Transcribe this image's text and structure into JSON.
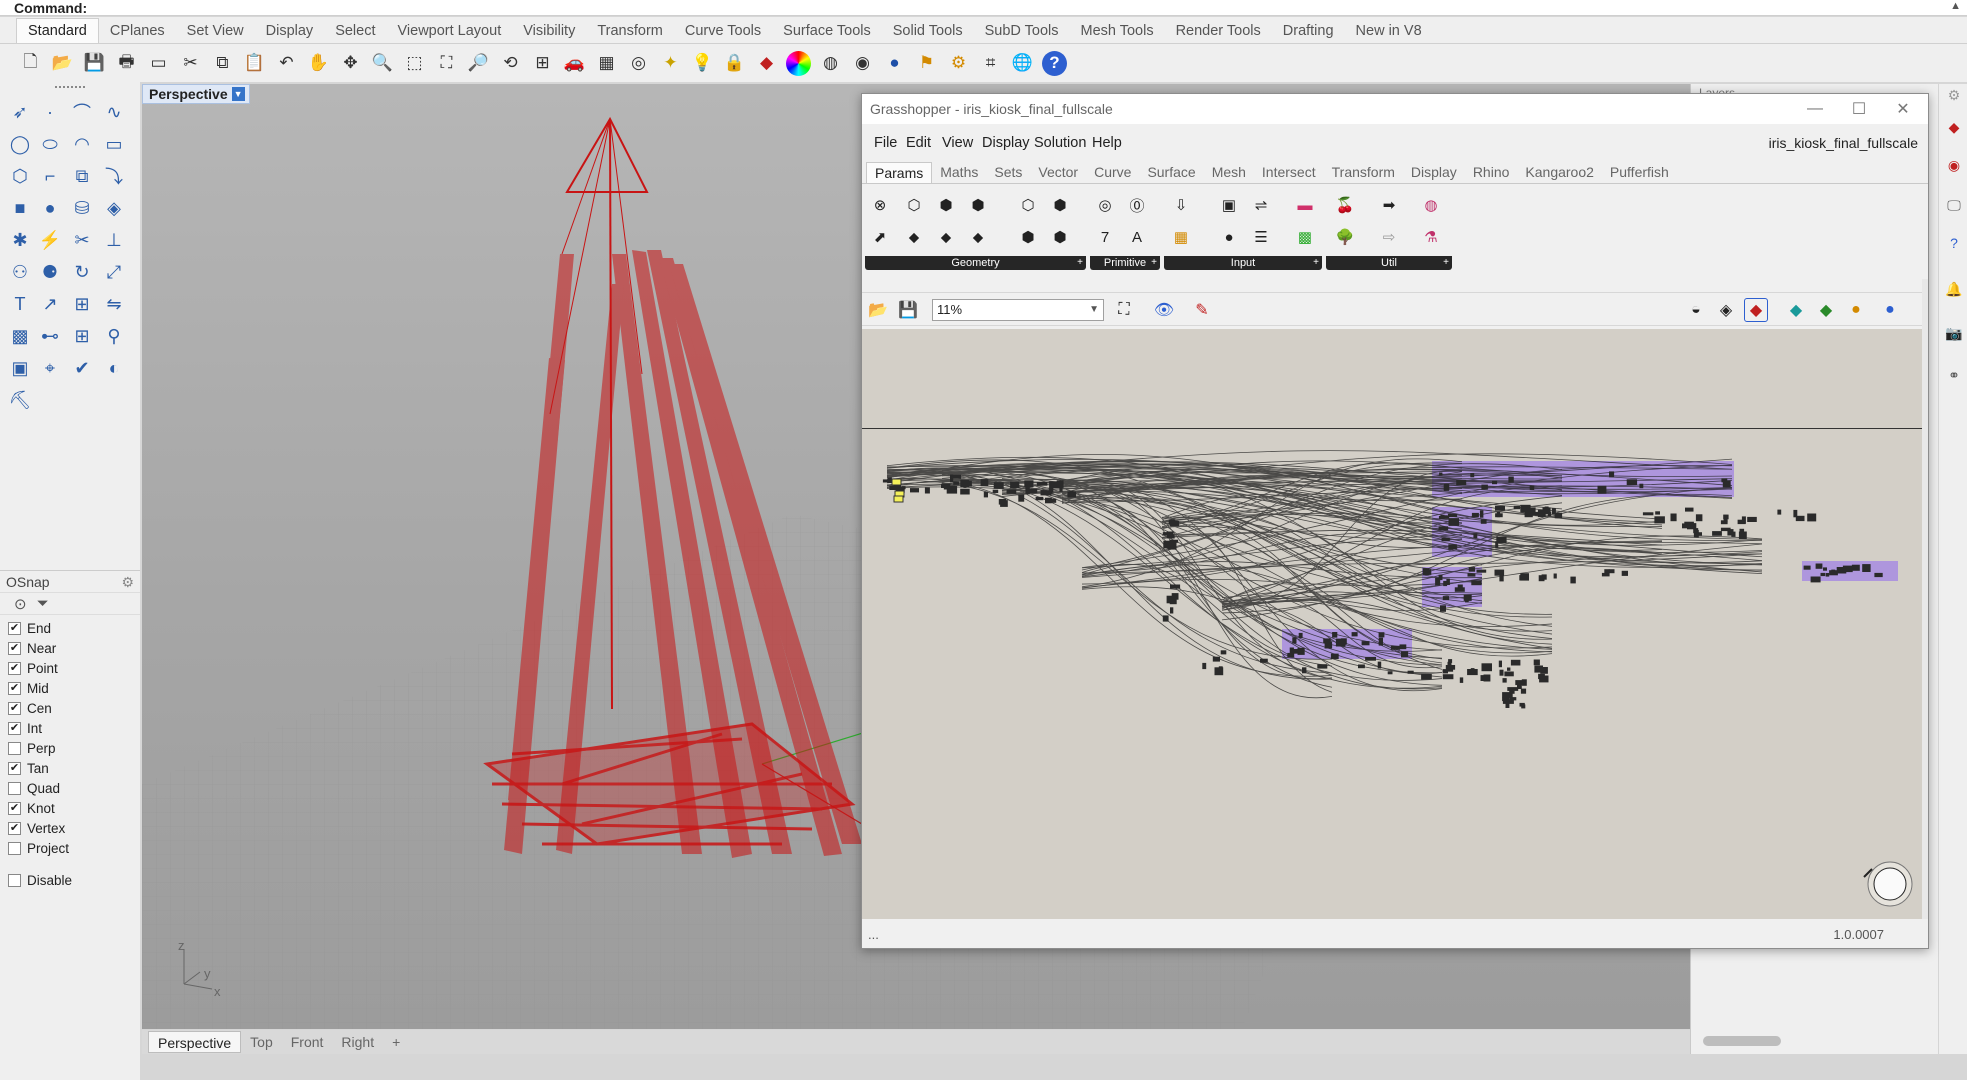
{
  "command_bar": {
    "label": "Command:"
  },
  "tabs": [
    "Standard",
    "CPlanes",
    "Set View",
    "Display",
    "Select",
    "Viewport Layout",
    "Visibility",
    "Transform",
    "Curve Tools",
    "Surface Tools",
    "Solid Tools",
    "SubD Tools",
    "Mesh Tools",
    "Render Tools",
    "Drafting",
    "New in V8"
  ],
  "active_tab": "Standard",
  "viewport": {
    "title": "Perspective",
    "axis_z": "z",
    "axis_y": "y",
    "axis_x": "x",
    "tabs": [
      "Perspective",
      "Top",
      "Front",
      "Right"
    ],
    "active_tab": "Perspective",
    "add_tab_icon": "+",
    "model_color": "#c81414"
  },
  "osnap": {
    "title": "OSnap",
    "items": [
      {
        "label": "End",
        "checked": true
      },
      {
        "label": "Near",
        "checked": true
      },
      {
        "label": "Point",
        "checked": true
      },
      {
        "label": "Mid",
        "checked": true
      },
      {
        "label": "Cen",
        "checked": true
      },
      {
        "label": "Int",
        "checked": true
      },
      {
        "label": "Perp",
        "checked": false
      },
      {
        "label": "Tan",
        "checked": true
      },
      {
        "label": "Quad",
        "checked": false
      },
      {
        "label": "Knot",
        "checked": true
      },
      {
        "label": "Vertex",
        "checked": true
      },
      {
        "label": "Project",
        "checked": false
      }
    ],
    "disable": {
      "label": "Disable",
      "checked": false
    }
  },
  "right_panel": {
    "layers_label": "Layers"
  },
  "grasshopper": {
    "title": "Grasshopper - iris_kiosk_final_fullscale",
    "doc_name": "iris_kiosk_final_fullscale",
    "menu": [
      "File",
      "Edit",
      "View",
      "Display",
      "Solution",
      "Help"
    ],
    "tabs": [
      "Params",
      "Maths",
      "Sets",
      "Vector",
      "Curve",
      "Surface",
      "Mesh",
      "Intersect",
      "Transform",
      "Display",
      "Rhino",
      "Kangaroo2",
      "Pufferfish"
    ],
    "active_tab": "Params",
    "ribbon_groups": [
      "Geometry",
      "Primitive",
      "Input",
      "Util"
    ],
    "zoom": "11%",
    "status_left": "...",
    "version": "1.0.0007",
    "group_color": "#a78ce0"
  }
}
